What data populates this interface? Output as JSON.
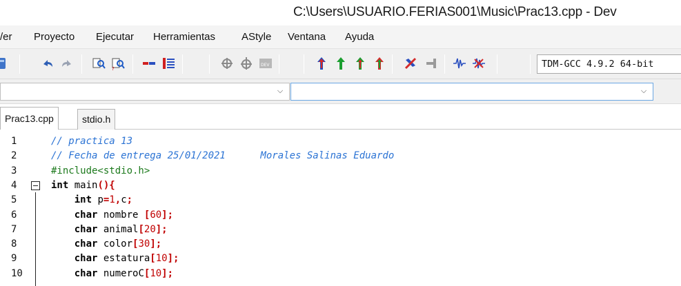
{
  "window": {
    "title": "C:\\Users\\USUARIO.FERIAS001\\Music\\Prac13.cpp - Dev"
  },
  "menu": {
    "items": [
      {
        "label": "/er",
        "x": 0
      },
      {
        "label": "Proyecto",
        "x": 0
      },
      {
        "label": "Ejecutar",
        "x": 0
      },
      {
        "label": "Herramientas",
        "x": 0
      },
      {
        "label": "AStyle",
        "x": 0
      },
      {
        "label": "Ventana",
        "x": 0
      },
      {
        "label": "Ayuda",
        "x": 0
      }
    ]
  },
  "toolbar": {
    "compiler": "TDM-GCC 4.9.2 64-bit",
    "icons": [
      "compile-run-icon",
      "undo-icon",
      "redo-icon",
      "find-icon",
      "replace-icon",
      "indent-icon",
      "unindent-icon",
      "class-browser-icon",
      "class-add-icon",
      "dev-icon",
      "compile-icon",
      "run-icon",
      "compile-run-green-icon",
      "rebuild-icon",
      "debug-icon",
      "stop-icon",
      "profile-icon",
      "profile-delete-icon"
    ]
  },
  "tabs": [
    {
      "label": "Prac13.cpp",
      "active": true
    },
    {
      "label": "stdio.h",
      "active": false
    }
  ],
  "editor": {
    "lines": [
      {
        "num": "1",
        "tokens": [
          {
            "t": "// practica 13",
            "c": "comment"
          }
        ]
      },
      {
        "num": "2",
        "tokens": [
          {
            "t": "// Fecha de entrega 25/01/2021      Morales Salinas Eduardo",
            "c": "comment"
          }
        ]
      },
      {
        "num": "3",
        "tokens": [
          {
            "t": "#include<stdio.h>",
            "c": "pre"
          }
        ]
      },
      {
        "num": "4",
        "fold": true,
        "tokens": [
          {
            "t": "int",
            "c": "kw"
          },
          {
            "t": " main",
            "c": "id"
          },
          {
            "t": "(){",
            "c": "sym"
          }
        ]
      },
      {
        "num": "5",
        "tokens": [
          {
            "t": "    ",
            "c": "id"
          },
          {
            "t": "int",
            "c": "kw"
          },
          {
            "t": " p",
            "c": "id"
          },
          {
            "t": "=",
            "c": "sym"
          },
          {
            "t": "1",
            "c": "num"
          },
          {
            "t": ",",
            "c": "sym"
          },
          {
            "t": "c",
            "c": "id"
          },
          {
            "t": ";",
            "c": "sym"
          }
        ]
      },
      {
        "num": "6",
        "tokens": [
          {
            "t": "    ",
            "c": "id"
          },
          {
            "t": "char",
            "c": "kw"
          },
          {
            "t": " nombre ",
            "c": "id"
          },
          {
            "t": "[",
            "c": "sym"
          },
          {
            "t": "60",
            "c": "num"
          },
          {
            "t": "];",
            "c": "sym"
          }
        ]
      },
      {
        "num": "7",
        "tokens": [
          {
            "t": "    ",
            "c": "id"
          },
          {
            "t": "char",
            "c": "kw"
          },
          {
            "t": " animal",
            "c": "id"
          },
          {
            "t": "[",
            "c": "sym"
          },
          {
            "t": "20",
            "c": "num"
          },
          {
            "t": "];",
            "c": "sym"
          }
        ]
      },
      {
        "num": "8",
        "tokens": [
          {
            "t": "    ",
            "c": "id"
          },
          {
            "t": "char",
            "c": "kw"
          },
          {
            "t": " color",
            "c": "id"
          },
          {
            "t": "[",
            "c": "sym"
          },
          {
            "t": "30",
            "c": "num"
          },
          {
            "t": "];",
            "c": "sym"
          }
        ]
      },
      {
        "num": "9",
        "tokens": [
          {
            "t": "    ",
            "c": "id"
          },
          {
            "t": "char",
            "c": "kw"
          },
          {
            "t": " estatura",
            "c": "id"
          },
          {
            "t": "[",
            "c": "sym"
          },
          {
            "t": "10",
            "c": "num"
          },
          {
            "t": "];",
            "c": "sym"
          }
        ]
      },
      {
        "num": "10",
        "tokens": [
          {
            "t": "    ",
            "c": "id"
          },
          {
            "t": "char",
            "c": "kw"
          },
          {
            "t": " numeroC",
            "c": "id"
          },
          {
            "t": "[",
            "c": "sym"
          },
          {
            "t": "10",
            "c": "num"
          },
          {
            "t": "];",
            "c": "sym"
          }
        ]
      }
    ]
  }
}
